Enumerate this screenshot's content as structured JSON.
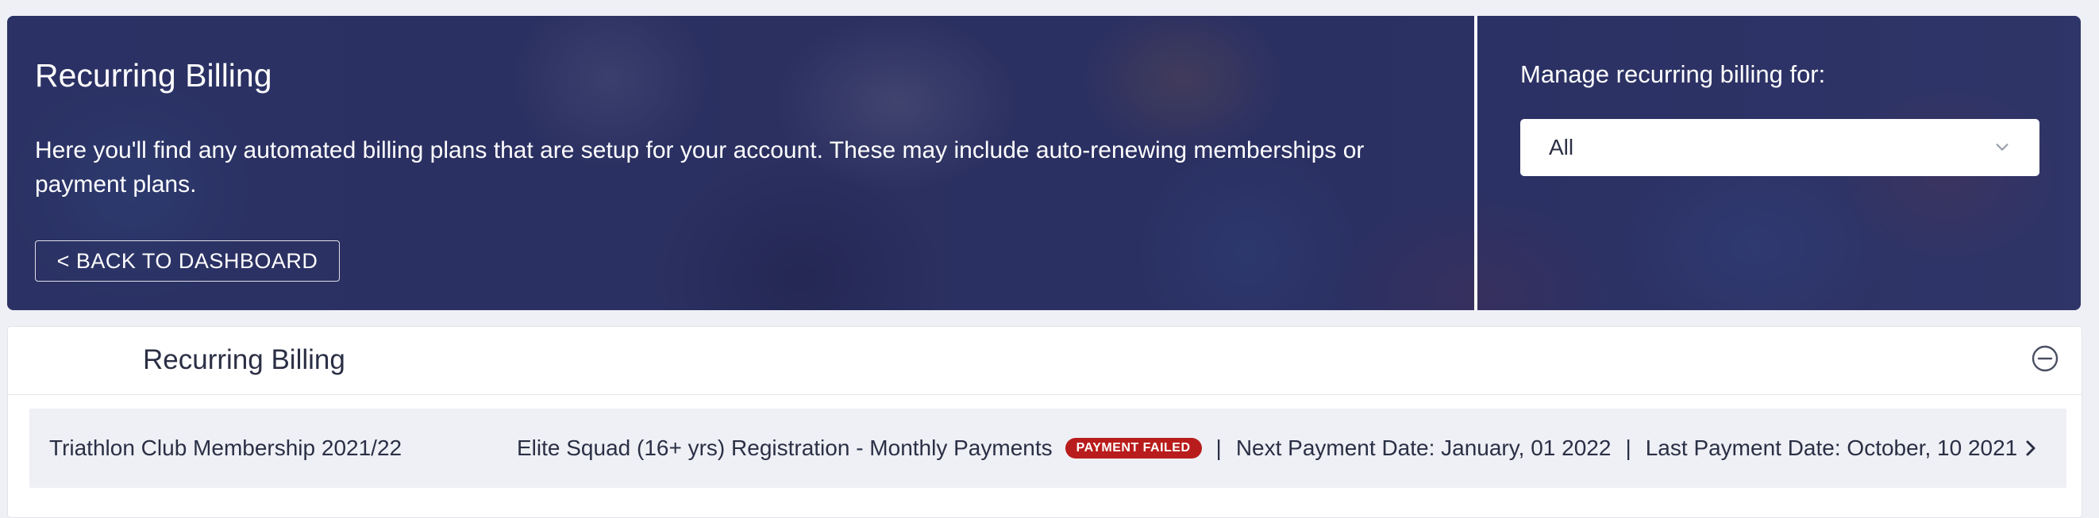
{
  "hero": {
    "title": "Recurring Billing",
    "description": "Here you'll find any automated billing plans that are setup for your account. These may include auto-renewing memberships or payment plans.",
    "back_button_label": "< BACK TO DASHBOARD",
    "manage_label": "Manage recurring billing for:",
    "select": {
      "value": "All",
      "icon": "chevron-down-icon"
    }
  },
  "card": {
    "title": "Recurring Billing",
    "collapse_icon": "minus-circle-icon",
    "rows": [
      {
        "name": "Triathlon Club Membership 2021/22",
        "plan": "Elite Squad (16+ yrs) Registration - Monthly Payments",
        "status": "PAYMENT FAILED",
        "separator": "|",
        "next_payment": "Next Payment Date: January, 01 2022",
        "last_payment": "Last Payment Date: October, 10 2021",
        "icon": "chevron-right-icon"
      }
    ]
  },
  "colors": {
    "hero_overlay": "#26285c",
    "status_failed": "#b91c1c",
    "page_background": "#eef0f5"
  }
}
